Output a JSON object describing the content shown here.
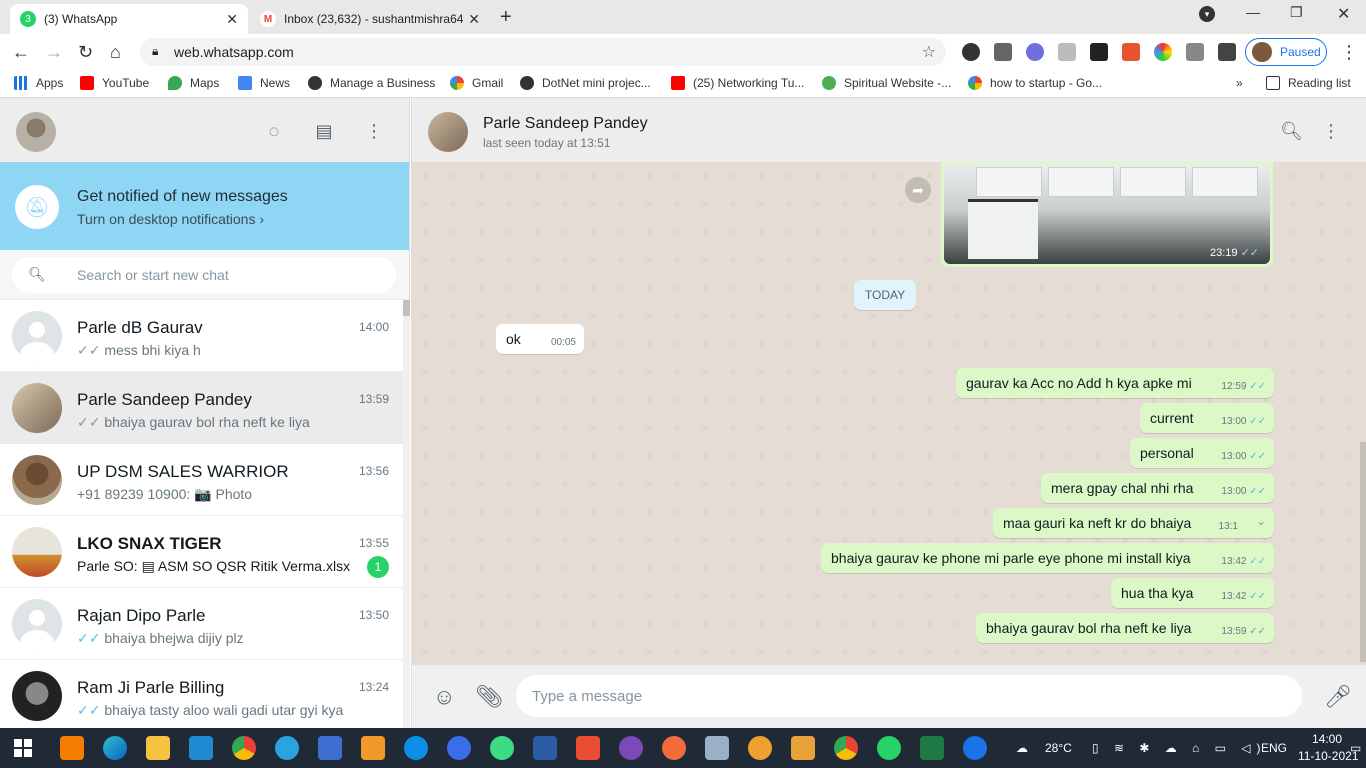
{
  "browser": {
    "tabs": [
      {
        "title": "(3) WhatsApp",
        "badge": "3",
        "fav_color": "#25d366"
      },
      {
        "title": "Inbox (23,632) - sushantmishra64",
        "fav_color": "#ea4335"
      }
    ],
    "url": "web.whatsapp.com",
    "profile_label": "Paused",
    "bookmarks": [
      "Apps",
      "YouTube",
      "Maps",
      "News",
      "Manage a Business",
      "Gmail",
      "DotNet mini projec...",
      "(25) Networking Tu...",
      "Spiritual Website -...",
      "how to startup - Go..."
    ],
    "more_bookmarks": "»",
    "reading_list": "Reading list"
  },
  "sidebar": {
    "notification": {
      "title": "Get notified of new messages",
      "subtitle": "Turn on desktop notifications ›"
    },
    "search_placeholder": "Search or start new chat",
    "chats": [
      {
        "name": "Parle dB Gaurav",
        "time": "14:00",
        "last": "mess bhi kiya h",
        "tick": "✓✓",
        "tick_color": "#8696a0",
        "avatar": "default"
      },
      {
        "name": "Parle Sandeep Pandey",
        "time": "13:59",
        "last": "bhaiya gaurav bol rha neft ke liya",
        "tick": "✓✓",
        "tick_color": "#8696a0",
        "avatar": "photo",
        "selected": true
      },
      {
        "name": "UP DSM SALES WARRIOR",
        "time": "13:56",
        "last": "+91 89239 10900: 📷 Photo",
        "tick": "",
        "avatar": "photo"
      },
      {
        "name": "LKO SNAX TIGER",
        "time": "13:55",
        "last": "Parle SO: ▤ ASM SO QSR Ritik Verma.xlsx",
        "tick": "",
        "avatar": "photo",
        "unread": "1",
        "bold": true
      },
      {
        "name": "Rajan Dipo Parle",
        "time": "13:50",
        "last": "bhaiya bhejwa dijiy plz",
        "tick": "✓✓",
        "tick_color": "#53bdeb",
        "avatar": "default"
      },
      {
        "name": "Ram Ji Parle Billing",
        "time": "13:24",
        "last": "bhaiya tasty aloo wali gadi utar gyi kya",
        "tick": "✓✓",
        "tick_color": "#53bdeb",
        "avatar": "photo"
      }
    ]
  },
  "conversation": {
    "contact_name": "Parle Sandeep Pandey",
    "status": "last seen today at 13:51",
    "image_time": "23:19",
    "day_chip": "TODAY",
    "incoming": [
      {
        "text": "ok",
        "time": "00:05"
      }
    ],
    "outgoing": [
      {
        "text": "gaurav ka Acc no Add h kya apke mi",
        "time": "12:59",
        "tick_color": "#53bdeb"
      },
      {
        "text": "current",
        "time": "13:00",
        "tick_color": "#53bdeb"
      },
      {
        "text": "personal",
        "time": "13:00",
        "tick_color": "#53bdeb"
      },
      {
        "text": "mera gpay chal nhi rha",
        "time": "13:00",
        "tick_color": "#53bdeb"
      },
      {
        "text": "maa gauri ka neft kr do bhaiya",
        "time": "13:1",
        "tick_color": "#53bdeb",
        "menu": true
      },
      {
        "text": "bhaiya gaurav ke phone mi parle eye phone mi install kiya",
        "time": "13:42",
        "tick_color": "#53bdeb"
      },
      {
        "text": "hua tha kya",
        "time": "13:42",
        "tick_color": "#53bdeb"
      },
      {
        "text": "bhaiya gaurav bol rha neft ke liya",
        "time": "13:59",
        "tick_color": "#8696a0"
      }
    ],
    "compose_placeholder": "Type a message"
  },
  "taskbar": {
    "weather": "28°C",
    "lang": "ENG",
    "time": "14:00",
    "date": "11-10-2021"
  }
}
